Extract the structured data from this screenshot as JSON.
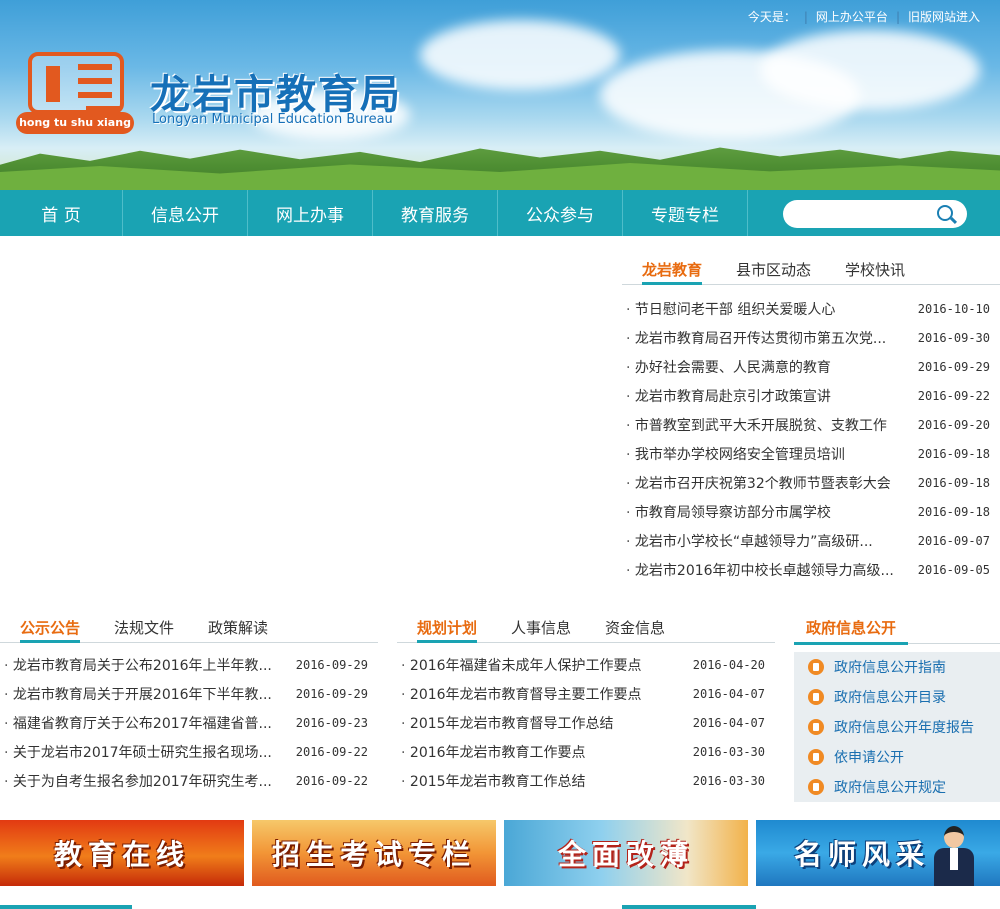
{
  "header": {
    "today_label": "今天是：",
    "links": [
      "网上办公平台",
      "旧版网站进入"
    ],
    "logo_text": "hong tu shu xiang",
    "title": "龙岩市教育局",
    "subtitle": "Longyan Municipal Education Bureau"
  },
  "nav": {
    "items": [
      "首 页",
      "信息公开",
      "网上办事",
      "教育服务",
      "公众参与",
      "专题专栏"
    ],
    "search_placeholder": ""
  },
  "news": {
    "tabs": [
      "龙岩教育",
      "县市区动态",
      "学校快讯"
    ],
    "items": [
      {
        "title": "节日慰问老干部 组织关爱暖人心",
        "date": "2016-10-10"
      },
      {
        "title": "龙岩市教育局召开传达贯彻市第五次党...",
        "date": "2016-09-30"
      },
      {
        "title": "办好社会需要、人民满意的教育",
        "date": "2016-09-29"
      },
      {
        "title": "龙岩市教育局赴京引才政策宣讲",
        "date": "2016-09-22"
      },
      {
        "title": "市普教室到武平大禾开展脱贫、支教工作",
        "date": "2016-09-20"
      },
      {
        "title": "我市举办学校网络安全管理员培训",
        "date": "2016-09-18"
      },
      {
        "title": "龙岩市召开庆祝第32个教师节暨表彰大会",
        "date": "2016-09-18"
      },
      {
        "title": "市教育局领导察访部分市属学校",
        "date": "2016-09-18"
      },
      {
        "title": "龙岩市小学校长“卓越领导力”高级研...",
        "date": "2016-09-07"
      },
      {
        "title": "龙岩市2016年初中校长卓越领导力高级...",
        "date": "2016-09-05"
      }
    ]
  },
  "notices": {
    "tabs": [
      "公示公告",
      "法规文件",
      "政策解读"
    ],
    "items": [
      {
        "title": "龙岩市教育局关于公布2016年上半年教...",
        "date": "2016-09-29"
      },
      {
        "title": "龙岩市教育局关于开展2016年下半年教...",
        "date": "2016-09-29"
      },
      {
        "title": "福建省教育厅关于公布2017年福建省普...",
        "date": "2016-09-23"
      },
      {
        "title": "关于龙岩市2017年硕士研究生报名现场...",
        "date": "2016-09-22"
      },
      {
        "title": "关于为自考生报名参加2017年研究生考...",
        "date": "2016-09-22"
      }
    ]
  },
  "plans": {
    "tabs": [
      "规划计划",
      "人事信息",
      "资金信息"
    ],
    "items": [
      {
        "title": "2016年福建省未成年人保护工作要点",
        "date": "2016-04-20"
      },
      {
        "title": "2016年龙岩市教育督导主要工作要点",
        "date": "2016-04-07"
      },
      {
        "title": "2015年龙岩市教育督导工作总结",
        "date": "2016-04-07"
      },
      {
        "title": "2016年龙岩市教育工作要点",
        "date": "2016-03-30"
      },
      {
        "title": "2015年龙岩市教育工作总结",
        "date": "2016-03-30"
      }
    ]
  },
  "gov_info": {
    "title": "政府信息公开",
    "items": [
      "政府信息公开指南",
      "政府信息公开目录",
      "政府信息公开年度报告",
      "依申请公开",
      "政府信息公开规定"
    ]
  },
  "promos": [
    "教育在线",
    "招生考试专栏",
    "全面改薄",
    "名师风采"
  ],
  "colors": {
    "nav": "#1aa3b3",
    "accent": "#e86b10",
    "link": "#1a6fb0"
  }
}
